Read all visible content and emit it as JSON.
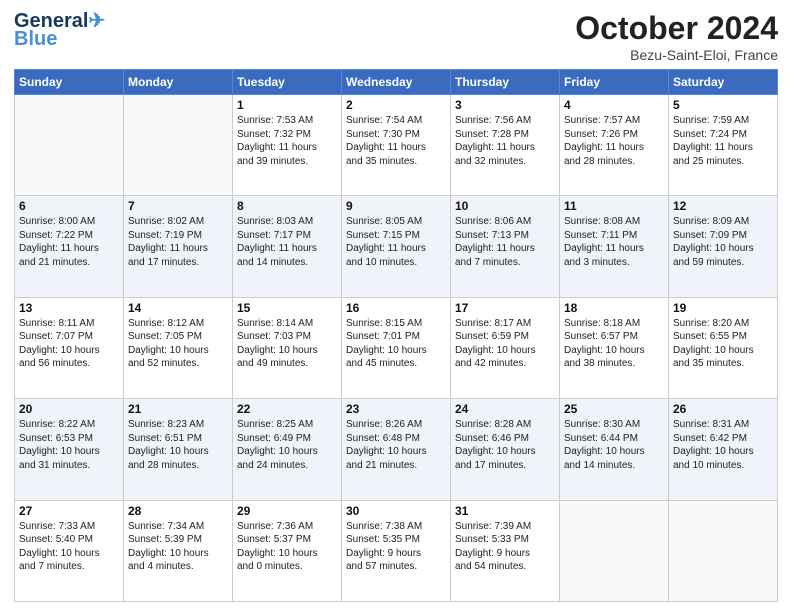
{
  "header": {
    "logo_line1": "General",
    "logo_line2": "Blue",
    "month": "October 2024",
    "location": "Bezu-Saint-Eloi, France"
  },
  "weekdays": [
    "Sunday",
    "Monday",
    "Tuesday",
    "Wednesday",
    "Thursday",
    "Friday",
    "Saturday"
  ],
  "weeks": [
    [
      {
        "day": "",
        "info": ""
      },
      {
        "day": "",
        "info": ""
      },
      {
        "day": "1",
        "info": "Sunrise: 7:53 AM\nSunset: 7:32 PM\nDaylight: 11 hours\nand 39 minutes."
      },
      {
        "day": "2",
        "info": "Sunrise: 7:54 AM\nSunset: 7:30 PM\nDaylight: 11 hours\nand 35 minutes."
      },
      {
        "day": "3",
        "info": "Sunrise: 7:56 AM\nSunset: 7:28 PM\nDaylight: 11 hours\nand 32 minutes."
      },
      {
        "day": "4",
        "info": "Sunrise: 7:57 AM\nSunset: 7:26 PM\nDaylight: 11 hours\nand 28 minutes."
      },
      {
        "day": "5",
        "info": "Sunrise: 7:59 AM\nSunset: 7:24 PM\nDaylight: 11 hours\nand 25 minutes."
      }
    ],
    [
      {
        "day": "6",
        "info": "Sunrise: 8:00 AM\nSunset: 7:22 PM\nDaylight: 11 hours\nand 21 minutes."
      },
      {
        "day": "7",
        "info": "Sunrise: 8:02 AM\nSunset: 7:19 PM\nDaylight: 11 hours\nand 17 minutes."
      },
      {
        "day": "8",
        "info": "Sunrise: 8:03 AM\nSunset: 7:17 PM\nDaylight: 11 hours\nand 14 minutes."
      },
      {
        "day": "9",
        "info": "Sunrise: 8:05 AM\nSunset: 7:15 PM\nDaylight: 11 hours\nand 10 minutes."
      },
      {
        "day": "10",
        "info": "Sunrise: 8:06 AM\nSunset: 7:13 PM\nDaylight: 11 hours\nand 7 minutes."
      },
      {
        "day": "11",
        "info": "Sunrise: 8:08 AM\nSunset: 7:11 PM\nDaylight: 11 hours\nand 3 minutes."
      },
      {
        "day": "12",
        "info": "Sunrise: 8:09 AM\nSunset: 7:09 PM\nDaylight: 10 hours\nand 59 minutes."
      }
    ],
    [
      {
        "day": "13",
        "info": "Sunrise: 8:11 AM\nSunset: 7:07 PM\nDaylight: 10 hours\nand 56 minutes."
      },
      {
        "day": "14",
        "info": "Sunrise: 8:12 AM\nSunset: 7:05 PM\nDaylight: 10 hours\nand 52 minutes."
      },
      {
        "day": "15",
        "info": "Sunrise: 8:14 AM\nSunset: 7:03 PM\nDaylight: 10 hours\nand 49 minutes."
      },
      {
        "day": "16",
        "info": "Sunrise: 8:15 AM\nSunset: 7:01 PM\nDaylight: 10 hours\nand 45 minutes."
      },
      {
        "day": "17",
        "info": "Sunrise: 8:17 AM\nSunset: 6:59 PM\nDaylight: 10 hours\nand 42 minutes."
      },
      {
        "day": "18",
        "info": "Sunrise: 8:18 AM\nSunset: 6:57 PM\nDaylight: 10 hours\nand 38 minutes."
      },
      {
        "day": "19",
        "info": "Sunrise: 8:20 AM\nSunset: 6:55 PM\nDaylight: 10 hours\nand 35 minutes."
      }
    ],
    [
      {
        "day": "20",
        "info": "Sunrise: 8:22 AM\nSunset: 6:53 PM\nDaylight: 10 hours\nand 31 minutes."
      },
      {
        "day": "21",
        "info": "Sunrise: 8:23 AM\nSunset: 6:51 PM\nDaylight: 10 hours\nand 28 minutes."
      },
      {
        "day": "22",
        "info": "Sunrise: 8:25 AM\nSunset: 6:49 PM\nDaylight: 10 hours\nand 24 minutes."
      },
      {
        "day": "23",
        "info": "Sunrise: 8:26 AM\nSunset: 6:48 PM\nDaylight: 10 hours\nand 21 minutes."
      },
      {
        "day": "24",
        "info": "Sunrise: 8:28 AM\nSunset: 6:46 PM\nDaylight: 10 hours\nand 17 minutes."
      },
      {
        "day": "25",
        "info": "Sunrise: 8:30 AM\nSunset: 6:44 PM\nDaylight: 10 hours\nand 14 minutes."
      },
      {
        "day": "26",
        "info": "Sunrise: 8:31 AM\nSunset: 6:42 PM\nDaylight: 10 hours\nand 10 minutes."
      }
    ],
    [
      {
        "day": "27",
        "info": "Sunrise: 7:33 AM\nSunset: 5:40 PM\nDaylight: 10 hours\nand 7 minutes."
      },
      {
        "day": "28",
        "info": "Sunrise: 7:34 AM\nSunset: 5:39 PM\nDaylight: 10 hours\nand 4 minutes."
      },
      {
        "day": "29",
        "info": "Sunrise: 7:36 AM\nSunset: 5:37 PM\nDaylight: 10 hours\nand 0 minutes."
      },
      {
        "day": "30",
        "info": "Sunrise: 7:38 AM\nSunset: 5:35 PM\nDaylight: 9 hours\nand 57 minutes."
      },
      {
        "day": "31",
        "info": "Sunrise: 7:39 AM\nSunset: 5:33 PM\nDaylight: 9 hours\nand 54 minutes."
      },
      {
        "day": "",
        "info": ""
      },
      {
        "day": "",
        "info": ""
      }
    ]
  ]
}
